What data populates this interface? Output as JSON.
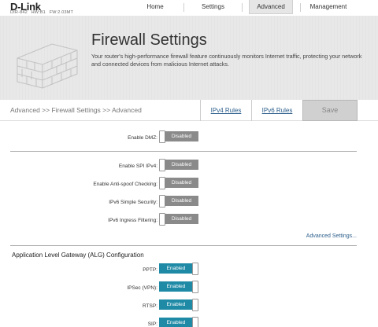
{
  "header": {
    "logo": "D-Link",
    "model": "DIR-842",
    "hw": "HW:B1",
    "fw": "FW:2.03MT",
    "nav": [
      {
        "label": "Home"
      },
      {
        "label": "Settings"
      },
      {
        "label": "Advanced"
      },
      {
        "label": "Management"
      }
    ]
  },
  "banner": {
    "title": "Firewall Settings",
    "description": "Your router's high-performance firewall feature continuously monitors Internet traffic, protecting your network and connected devices from malicious Internet attacks."
  },
  "toolbar": {
    "breadcrumb": "Advanced >> Firewall Settings >> Advanced",
    "ipv4_tab": "IPv4 Rules",
    "ipv6_tab": "IPv6 Rules",
    "save": "Save"
  },
  "settings": {
    "dmz": {
      "label": "Enable DMZ:",
      "state": "Disabled"
    },
    "spi": {
      "label": "Enable SPI IPv4:",
      "state": "Disabled"
    },
    "antispoof": {
      "label": "Enable Anti-spoof Checking:",
      "state": "Disabled"
    },
    "ipv6_simple": {
      "label": "IPv6 Simple Security:",
      "state": "Disabled"
    },
    "ipv6_ingress": {
      "label": "IPv6 Ingress Filtering:",
      "state": "Disabled"
    }
  },
  "advanced_link": "Advanced Settings...",
  "alg": {
    "title": "Application Level Gateway (ALG) Configuration",
    "items": [
      {
        "label": "PPTP:",
        "state": "Enabled"
      },
      {
        "label": "IPSec (VPN):",
        "state": "Enabled"
      },
      {
        "label": "RTSP:",
        "state": "Enabled"
      },
      {
        "label": "SIP:",
        "state": "Enabled"
      }
    ]
  }
}
